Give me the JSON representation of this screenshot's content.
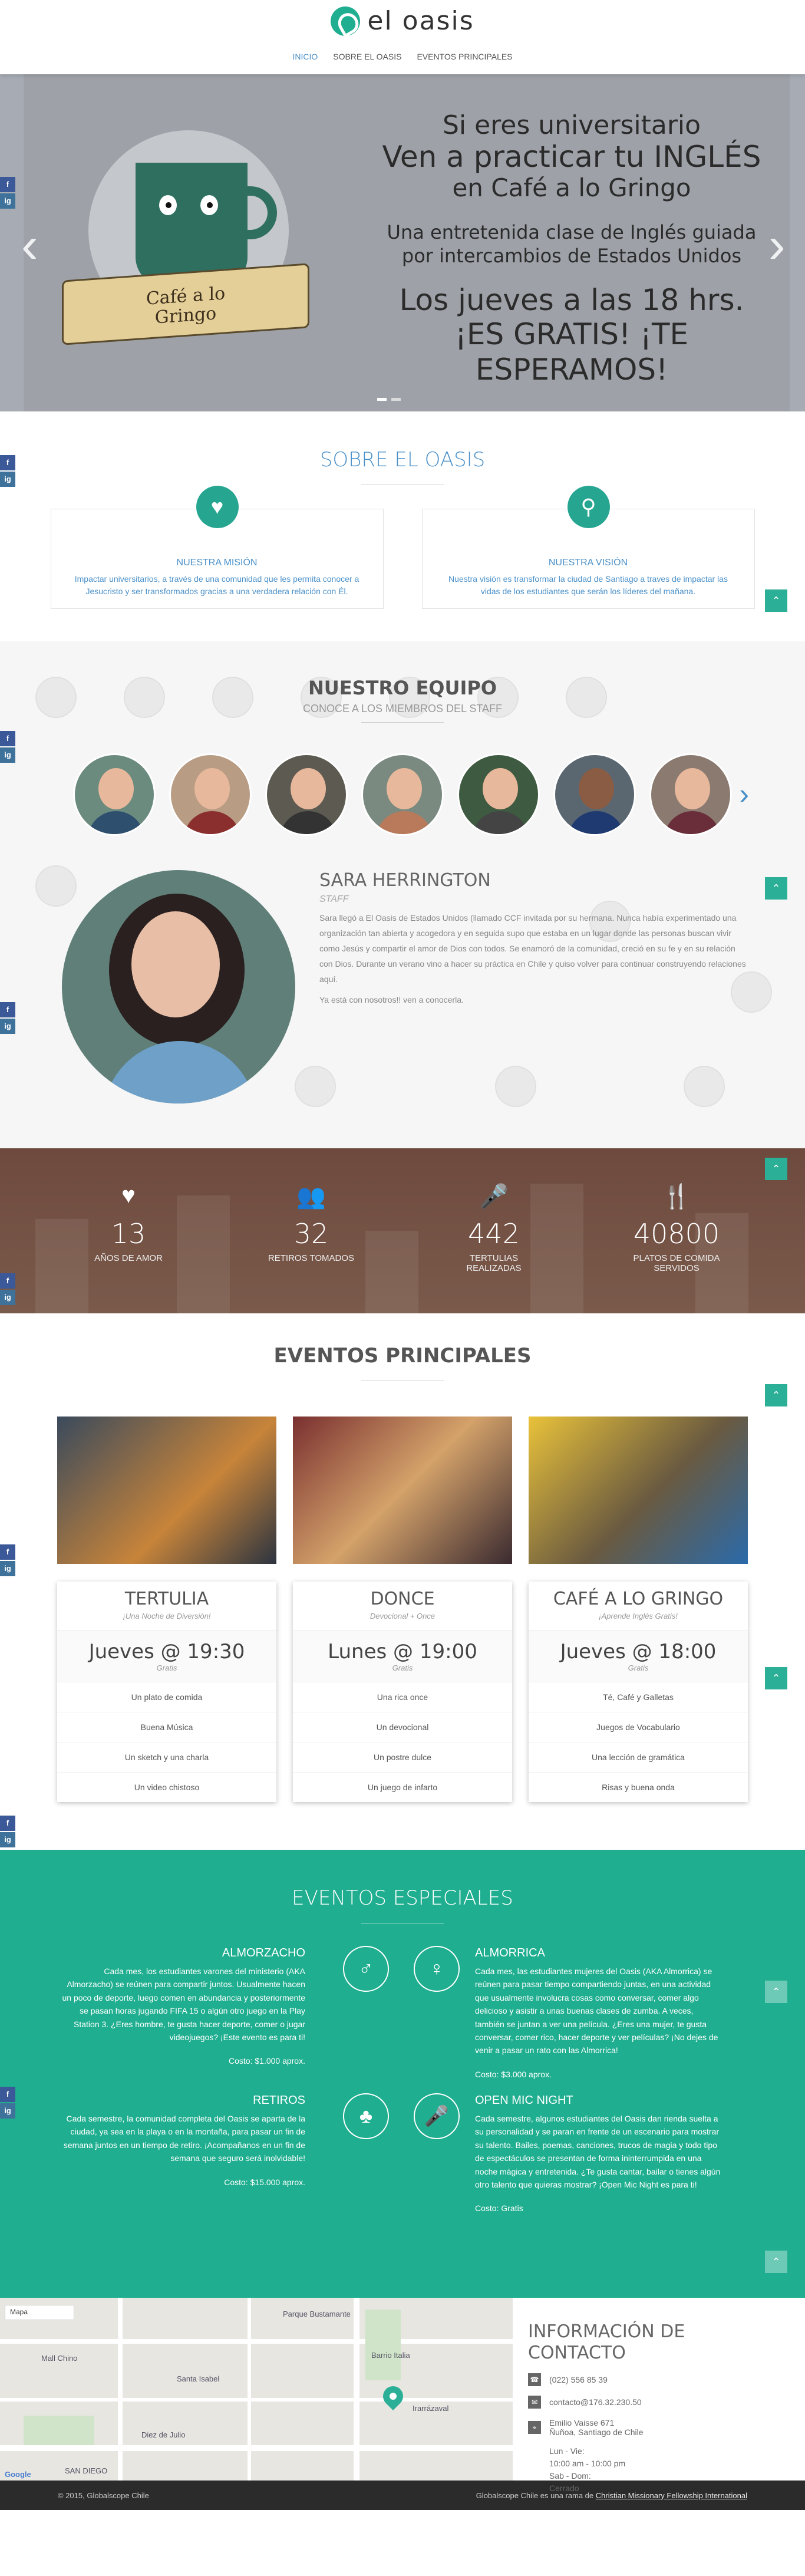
{
  "header": {
    "logo_text": "el oasis",
    "nav": [
      {
        "label": "INICIO",
        "active": true
      },
      {
        "label": "SOBRE EL OASIS",
        "active": false
      },
      {
        "label": "EVENTOS PRINCIPALES",
        "active": false
      }
    ]
  },
  "social": {
    "facebook": "f",
    "instagram": "ig"
  },
  "hero": {
    "line1": "Si eres universitario",
    "line2": "Ven a practicar tu INGLÉS",
    "line3": "en Café a lo Gringo",
    "line4": "Una entretenida clase de Inglés guiada",
    "line5": "por intercambios de Estados Unidos",
    "line6": "Los jueves a las 18 hrs.",
    "line7": "¡ES GRATIS! ¡TE ESPERAMOS!",
    "banner_line1": "Café a lo",
    "banner_line2": "Gringo",
    "prev_label": "‹",
    "next_label": "›",
    "slides": 2,
    "active_slide": 1
  },
  "sobre": {
    "title": "SOBRE EL OASIS",
    "mision": {
      "icon": "heart-icon",
      "heading": "NUESTRA MISIÓN",
      "text": "Impactar universitarios, a través de una comunidad que les permita conocer a Jesucristo y ser transformados gracias a una verdadera relación con Él."
    },
    "vision": {
      "icon": "search-icon",
      "heading": "NUESTRA VISIÓN",
      "text": "Nuestra visión es transformar la ciudad de Santiago a traves de impactar las vidas de los estudiantes que serán los líderes del mañana."
    },
    "up_label": "⌃"
  },
  "equipo": {
    "title": "NUESTRO EQUIPO",
    "subtitle": "CONOCE A LOS MIEMBROS DEL STAFF",
    "members_count": 7,
    "next_label": "›",
    "profile": {
      "name": "SARA HERRINGTON",
      "role": "STAFF",
      "bio": "Sara llegó a El Oasis de Estados Unidos (llamado CCF invitada por su hermana. Nunca había experimentado una organización tan abierta y acogedora y en seguida supo que estaba en un lugar donde las personas buscan vivir como Jesús y compartir el amor de Dios con todos. Se enamoró de la comunidad, creció en su fe y en su relación con Dios. Durante un verano vino a hacer su práctica en Chile y quiso volver para continuar construyendo relaciones aquí.",
      "cta": "Ya está con nosotros!! ven a conocerla."
    }
  },
  "stats": [
    {
      "icon": "heart-icon",
      "value": "13",
      "label": "AÑOS DE AMOR"
    },
    {
      "icon": "people-icon",
      "value": "32",
      "label": "RETIROS TOMADOS"
    },
    {
      "icon": "microphone-icon",
      "value": "442",
      "label": "TERTULIAS REALIZADAS"
    },
    {
      "icon": "cutlery-icon",
      "value": "40800",
      "label": "PLATOS DE COMIDA SERVIDOS"
    }
  ],
  "eventos": {
    "title": "EVENTOS PRINCIPALES",
    "items": [
      {
        "name": "TERTULIA",
        "subtitle": "¡Una Noche de Diversión!",
        "time": "Jueves @ 19:30",
        "price": "Gratis",
        "features": [
          "Un plato de comida",
          "Buena Música",
          "Un sketch y una charla",
          "Un video chistoso"
        ]
      },
      {
        "name": "DONCE",
        "subtitle": "Devocional + Once",
        "time": "Lunes @ 19:00",
        "price": "Gratis",
        "features": [
          "Una rica once",
          "Un devocional",
          "Un postre dulce",
          "Un juego de infarto"
        ]
      },
      {
        "name": "CAFÉ A LO GRINGO",
        "subtitle": "¡Aprende Inglés Gratis!",
        "time": "Jueves @ 18:00",
        "price": "Gratis",
        "features": [
          "Té, Café y Galletas",
          "Juegos de Vocabulario",
          "Una lección de gramática",
          "Risas y buena onda"
        ]
      }
    ]
  },
  "especiales": {
    "title": "EVENTOS ESPECIALES",
    "items": [
      {
        "name": "ALMORZACHO",
        "icon": "male-icon",
        "text": "Cada mes, los estudiantes varones del ministerio (AKA Almorzacho) se reúnen para compartir juntos. Usualmente hacen un poco de deporte, luego comen en abundancia y posteriormente se pasan horas jugando FIFA 15 o algún otro juego en la Play Station 3. ¿Eres hombre, te gusta hacer deporte, comer o jugar videojuegos? ¡Este evento es para ti!",
        "cost": "Costo: $1.000 aprox."
      },
      {
        "name": "ALMORRICA",
        "icon": "female-icon",
        "text": "Cada mes, las estudiantes mujeres del Oasis (AKA Almorrica) se reúnen para pasar tiempo compartiendo juntas, en una actividad que usualmente involucra cosas como conversar, comer algo delicioso y asistir a unas buenas clases de zumba. A veces, también se juntan a ver una película. ¿Eres una mujer, te gusta conversar, comer rico, hacer deporte y ver películas? ¡No dejes de venir a pasar un rato con las Almorrica!",
        "cost": "Costo: $3.000 aprox."
      },
      {
        "name": "RETIROS",
        "icon": "tree-icon",
        "text": "Cada semestre, la comunidad completa del Oasis se aparta de la ciudad, ya sea en la playa o en la montaña, para pasar un fin de semana juntos en un tiempo de retiro. ¡Acompañanos en un fin de semana que seguro será inolvidable!",
        "cost": "Costo: $15.000 aprox."
      },
      {
        "name": "OPEN MIC NIGHT",
        "icon": "microphone-icon",
        "text": "Cada semestre, algunos estudiantes del Oasis dan rienda suelta a su personalidad y se paran en frente de un escenario para mostrar su talento. Bailes, poemas, canciones, trucos de magia y todo tipo de espectáculos se presentan de forma ininterrumpida en una noche mágica y entretenida. ¿Te gusta cantar, bailar o tienes algún otro talento que quieras mostrar? ¡Open Mic Night es para ti!",
        "cost": "Costo: Gratis"
      }
    ]
  },
  "contacto": {
    "title_line1": "INFORMACIÓN DE",
    "title_line2": "CONTACTO",
    "phone": "(022) 556 85 39",
    "email": "contacto@176.32.230.50",
    "address_line1": "Emilio Vaisse 671",
    "address_line2": "Ñuñoa, Santiago de Chile",
    "hours": [
      "Lun - Vie:",
      "10:00 am - 10:00 pm",
      "Sab - Dom:",
      "Cerrado"
    ],
    "map_type": "Mapa",
    "map_labels": [
      "Mall Chino",
      "SAN DIEGO",
      "Diez de Julio",
      "Barrio Italia",
      "Parque Bustamante",
      "Santa Isabel",
      "Irarrázaval",
      "Google"
    ]
  },
  "footer": {
    "copyright": "© 2015, Globalscope Chile",
    "credit_text": "Globalscope Chile es una rama de",
    "credit_link": "Christian Missionary Fellowship International"
  },
  "colors": {
    "accent": "#1fae8f",
    "link": "#4a90c8",
    "facebook": "#3b5998",
    "instagram": "#3f729b"
  }
}
